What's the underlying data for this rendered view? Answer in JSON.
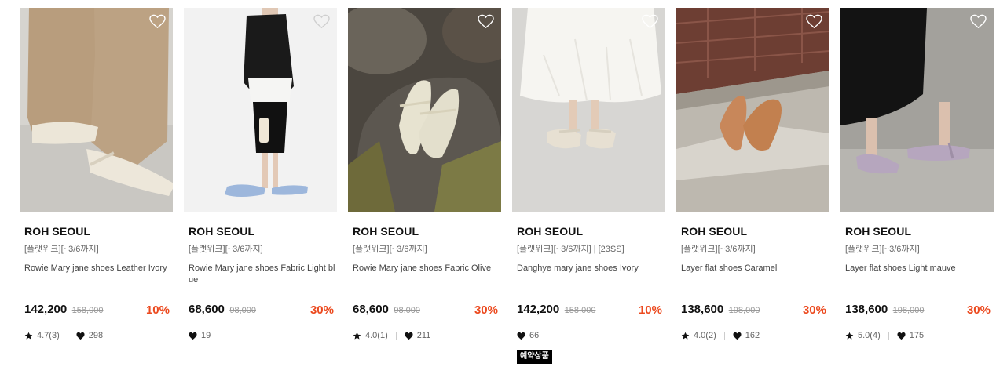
{
  "products": [
    {
      "brand": "ROH SEOUL",
      "promo": "[플랫위크][~3/6까지]",
      "name": "Rowie Mary jane shoes Leather Ivory",
      "price": "142,200",
      "original_price": "158,000",
      "discount": "10%",
      "rating": "4.7(3)",
      "likes": "298",
      "wish_icon": "heart-outline-icon",
      "image": {
        "bg": "#d8d6d2",
        "floor": "#cfcdc8",
        "wear": "#b59b7c",
        "shoe": "#ece6d8"
      }
    },
    {
      "brand": "ROH SEOUL",
      "promo": "[플랫위크][~3/6까지]",
      "name": "Rowie Mary jane shoes Fabric Light blue",
      "price": "68,600",
      "original_price": "98,000",
      "discount": "30%",
      "rating": "",
      "likes": "19",
      "wish_icon": "heart-outline-icon",
      "image": {
        "bg": "#f1f1f1",
        "floor": "#e9e9e9",
        "wear": "#1b1b1b",
        "shoe": "#9db7dc"
      }
    },
    {
      "brand": "ROH SEOUL",
      "promo": "[플랫위크][~3/6까지]",
      "name": "Rowie Mary jane shoes Fabric Olive",
      "price": "68,600",
      "original_price": "98,000",
      "discount": "30%",
      "rating": "4.0(1)",
      "likes": "211",
      "wish_icon": "heart-outline-icon",
      "image": {
        "bg": "#5f584e",
        "floor": "#4a4640",
        "wear": "#7a8a4a",
        "shoe": "#e3dfcc"
      }
    },
    {
      "brand": "ROH SEOUL",
      "promo": "[플랫위크][~3/6까지] | [23SS]",
      "name": "Danghye mary jane shoes Ivory",
      "price": "142,200",
      "original_price": "158,000",
      "discount": "10%",
      "rating": "",
      "likes": "66",
      "badge": "예약상품",
      "wish_icon": "heart-outline-icon",
      "image": {
        "bg": "#d9d8d5",
        "floor": "#cfcecb",
        "wear": "#f4f3ef",
        "shoe": "#e7e0d2"
      }
    },
    {
      "brand": "ROH SEOUL",
      "promo": "[플랫위크][~3/6까지]",
      "name": "Layer flat shoes Caramel",
      "price": "138,600",
      "original_price": "198,000",
      "discount": "30%",
      "rating": "4.0(2)",
      "likes": "162",
      "wish_icon": "heart-outline-icon",
      "image": {
        "bg": "#6b5b52",
        "floor": "#bdb7ad",
        "wear": "#8a3b2a",
        "shoe": "#c8875a"
      }
    },
    {
      "brand": "ROH SEOUL",
      "promo": "[플랫위크][~3/6까지]",
      "name": "Layer flat shoes Light mauve",
      "price": "138,600",
      "original_price": "198,000",
      "discount": "30%",
      "rating": "5.0(4)",
      "likes": "175",
      "wish_icon": "heart-outline-icon",
      "image": {
        "bg": "#9e9c98",
        "floor": "#b4b2ad",
        "wear": "#141414",
        "shoe": "#b6a6be"
      }
    }
  ],
  "colors": {
    "discount": "#ec4a1f",
    "badge_bg": "#000000"
  }
}
